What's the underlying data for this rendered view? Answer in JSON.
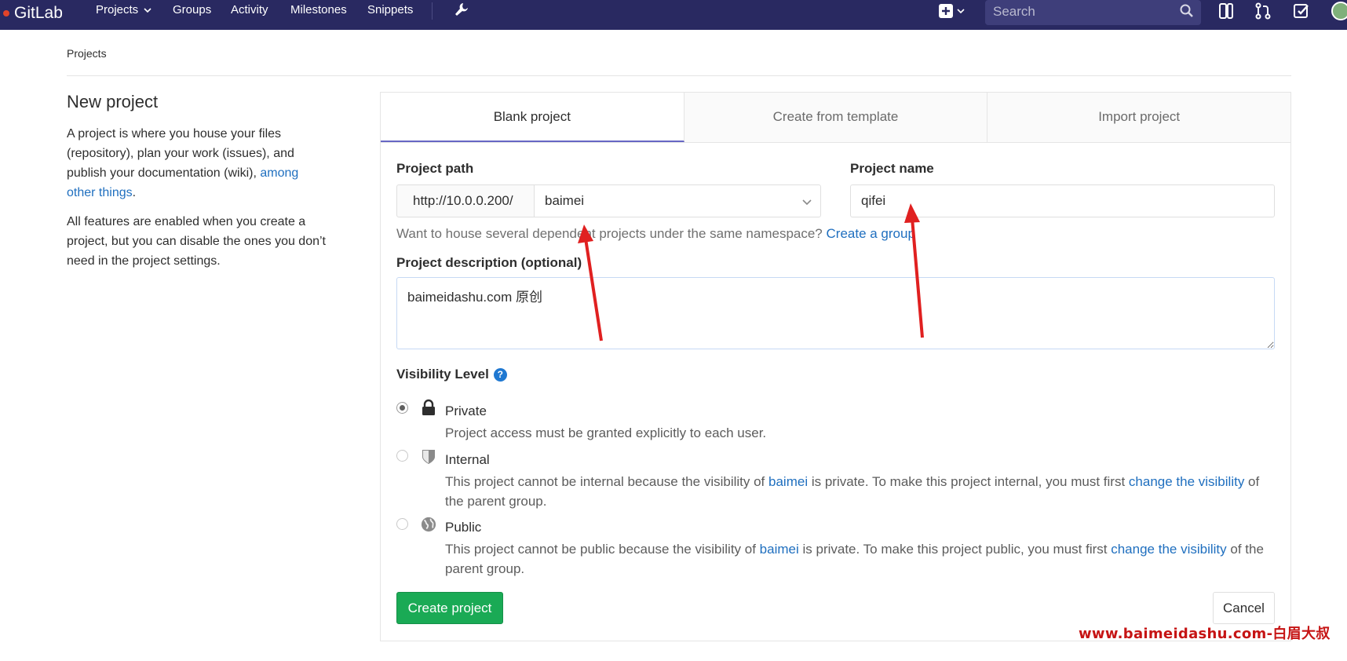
{
  "navbar": {
    "brand": "GitLab",
    "links": [
      {
        "id": "projects",
        "label": "Projects",
        "has_dropdown": true
      },
      {
        "id": "groups",
        "label": "Groups"
      },
      {
        "id": "activity",
        "label": "Activity"
      },
      {
        "id": "milestones",
        "label": "Milestones"
      },
      {
        "id": "snippets",
        "label": "Snippets"
      }
    ],
    "search_placeholder": "Search",
    "icons": [
      "wrench-icon",
      "plus-icon",
      "search-icon",
      "issues-icon",
      "merge-request-icon",
      "todo-icon",
      "avatar"
    ]
  },
  "breadcrumb": "Projects",
  "sidebar": {
    "title": "New project",
    "intro_text": "A project is where you house your files (repository), plan your work (issues), and publish your documentation (wiki), ",
    "intro_link": "among other things",
    "intro_end": ".",
    "features_text": "All features are enabled when you create a project, but you can disable the ones you don’t need in the project settings."
  },
  "tabs": [
    {
      "label": "Blank project",
      "active": true
    },
    {
      "label": "Create from template",
      "active": false
    },
    {
      "label": "Import project",
      "active": false
    }
  ],
  "form": {
    "project_path_label": "Project path",
    "path_prefix": "http://10.0.0.200/",
    "namespace_value": "baimei",
    "project_name_label": "Project name",
    "project_name_value": "qifei",
    "help_text": "Want to house several dependent projects under the same namespace? ",
    "help_link": "Create a group",
    "description_label": "Project description (optional)",
    "description_value": "baimeidashu.com 原创",
    "visibility_label": "Visibility Level",
    "visibility_options": [
      {
        "id": "private",
        "title": "Private",
        "icon": "lock-icon",
        "checked": true,
        "desc": "Project access must be granted explicitly to each user."
      },
      {
        "id": "internal",
        "title": "Internal",
        "icon": "shield-icon",
        "checked": false,
        "desc_a": "This project cannot be internal because the visibility of ",
        "desc_link1": "baimei",
        "desc_b": " is private. To make this project internal, you must first ",
        "desc_link2": "change the visibility",
        "desc_c": " of the parent group."
      },
      {
        "id": "public",
        "title": "Public",
        "icon": "globe-icon",
        "checked": false,
        "desc_a": "This project cannot be public because the visibility of ",
        "desc_link1": "baimei",
        "desc_b": " is private. To make this project public, you must first ",
        "desc_link2": "change the visibility",
        "desc_c": " of the parent group."
      }
    ],
    "create_button": "Create project",
    "cancel_button": "Cancel"
  },
  "watermark": "www.baimeidashu.com-白眉大叔",
  "colors": {
    "navbar": "#292961",
    "accent": "#6666c4",
    "link": "#1f6fbf",
    "create_button": "#1aaa55",
    "annotation_arrow": "#e02020",
    "watermark": "#c61414"
  }
}
